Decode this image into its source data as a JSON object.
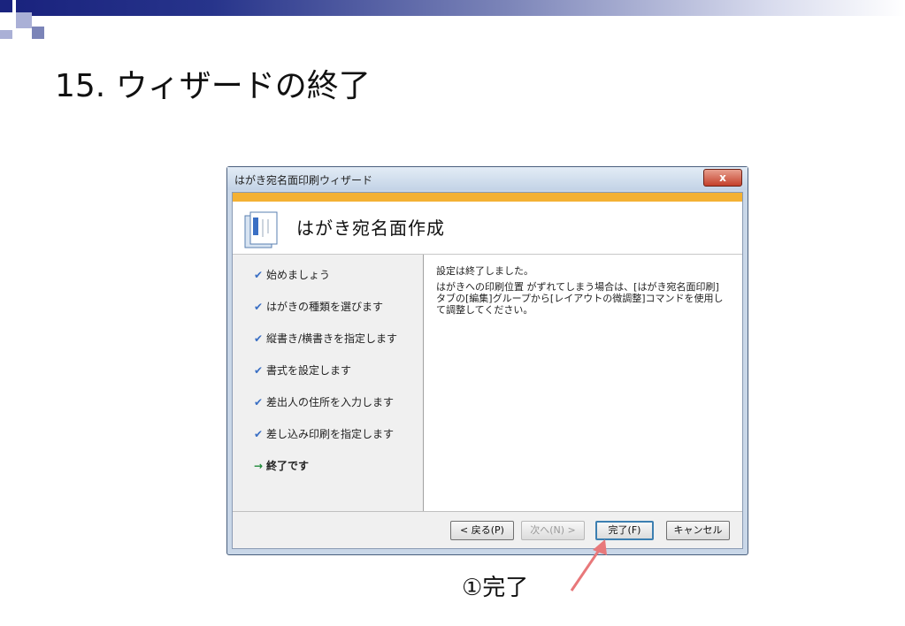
{
  "slide": {
    "title": "15. ウィザードの終了",
    "annotation": "①完了"
  },
  "window": {
    "title": "はがき宛名面印刷ウィザード",
    "close_label": "x"
  },
  "header": {
    "title": "はがき宛名面作成"
  },
  "steps": [
    {
      "mark": "✔",
      "label": "始めましょう",
      "state": "done"
    },
    {
      "mark": "✔",
      "label": "はがきの種類を選びます",
      "state": "done"
    },
    {
      "mark": "✔",
      "label": "縦書き/横書きを指定します",
      "state": "done"
    },
    {
      "mark": "✔",
      "label": "書式を設定します",
      "state": "done"
    },
    {
      "mark": "✔",
      "label": "差出人の住所を入力します",
      "state": "done"
    },
    {
      "mark": "✔",
      "label": "差し込み印刷を指定します",
      "state": "done"
    },
    {
      "mark": "→",
      "label": "終了です",
      "state": "current"
    }
  ],
  "content": {
    "line1": "設定は終了しました。",
    "line2": "はがきへの印刷位置 がずれてしまう場合は、[はがき宛名面印刷]タブの[編集]グループから[レイアウトの微調整]コマンドを使用して調整してください。"
  },
  "buttons": {
    "back": "< 戻る(P)",
    "next": "次へ(N) >",
    "finish": "完了(F)",
    "cancel": "キャンセル"
  },
  "colors": {
    "header_accent": "#f4b133",
    "check": "#3a6fc4",
    "arrow_current": "#1f8a3a",
    "annotation_arrow": "#e8787a"
  }
}
